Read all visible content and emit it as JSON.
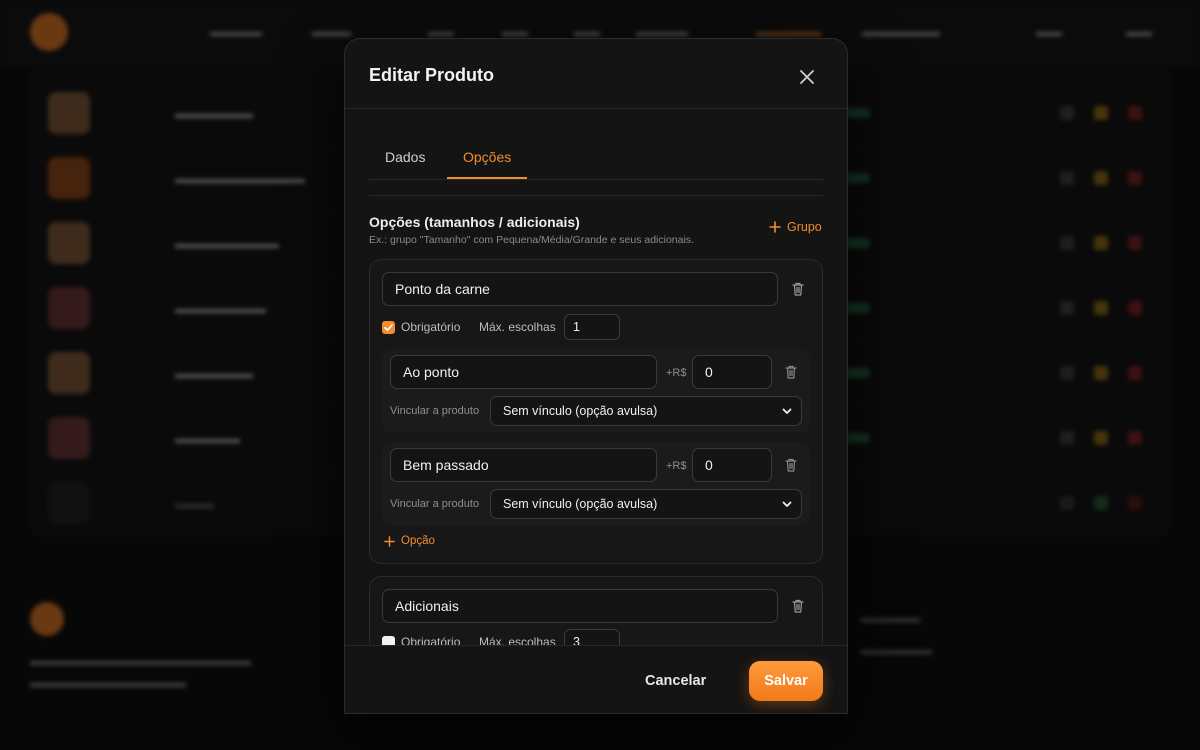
{
  "modal": {
    "title": "Editar Produto",
    "close_icon": "close-icon",
    "tabs": [
      {
        "label": "Dados",
        "active": false
      },
      {
        "label": "Opções",
        "active": true
      }
    ],
    "section": {
      "title": "Opções (tamanhos / adicionais)",
      "hint": "Ex.: grupo \"Tamanho\" com Pequena/Média/Grande e seus adicionais.",
      "add_group_label": "Grupo"
    },
    "groups": [
      {
        "name": "Ponto da carne",
        "required": true,
        "required_label": "Obrigatório",
        "max_label": "Máx. escolhas",
        "max_value": "1",
        "options": [
          {
            "name": "Ao ponto",
            "price_prefix": "+R$",
            "price": "0",
            "link_label": "Vincular a produto",
            "link_value": "Sem vínculo (opção avulsa)"
          },
          {
            "name": "Bem passado",
            "price_prefix": "+R$",
            "price": "0",
            "link_label": "Vincular a produto",
            "link_value": "Sem vínculo (opção avulsa)"
          }
        ],
        "add_option_label": "Opção"
      },
      {
        "name": "Adicionais",
        "required": false,
        "required_label": "Obrigatório",
        "max_label": "Máx. escolhas",
        "max_value": "3"
      }
    ],
    "footer": {
      "cancel_label": "Cancelar",
      "save_label": "Salvar"
    }
  },
  "colors": {
    "accent": "#f28c2e",
    "modal_bg": "#141414",
    "overlay": "#070707"
  }
}
